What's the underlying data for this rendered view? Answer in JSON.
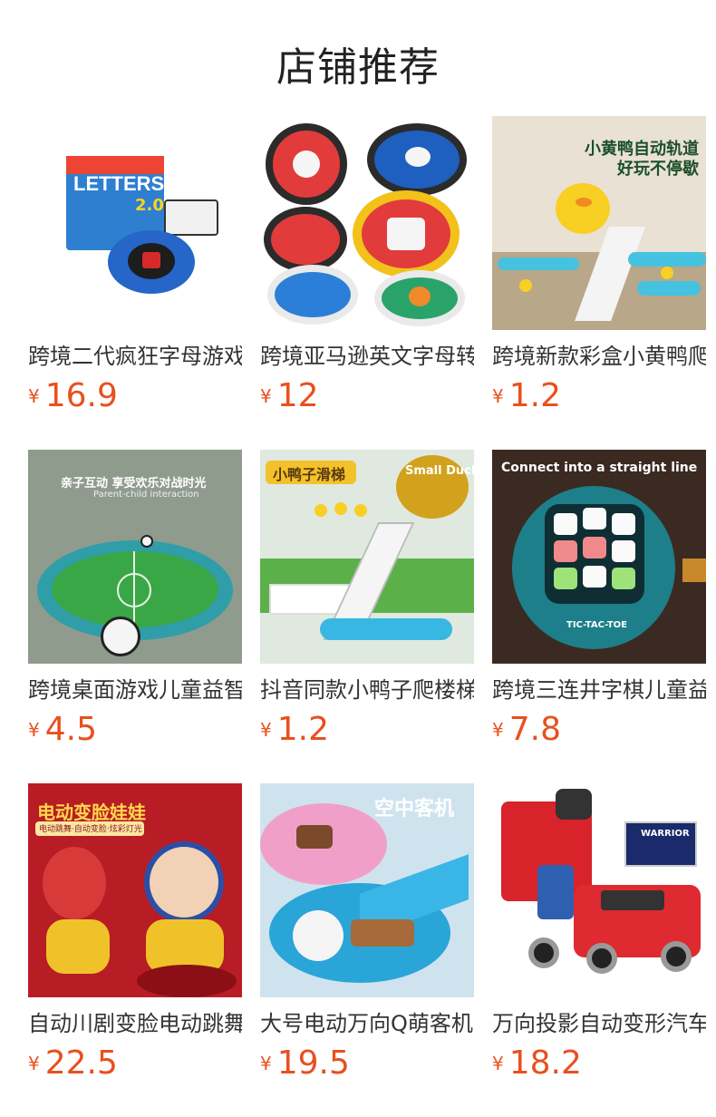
{
  "page_title": "店铺推荐",
  "currency_symbol": "¥",
  "products": [
    {
      "name": "跨境二代疯狂字母游戏",
      "price": "16.9",
      "image_text": "LETTERS",
      "image_text2": "2.0"
    },
    {
      "name": "跨境亚马逊英文字母转盘",
      "price": "12"
    },
    {
      "name": "跨境新款彩盒小黄鸭爬楼梯",
      "price": "1.2",
      "image_text": "小黄鸭自动轨道",
      "image_text2": "好玩不停歇"
    },
    {
      "name": "跨境桌面游戏儿童益智足球",
      "price": "4.5",
      "image_text": "亲子互动 享受欢乐对战时光",
      "image_text2": "Parent-child interaction"
    },
    {
      "name": "抖音同款小鸭子爬楼梯",
      "price": "1.2",
      "image_text": "小鸭子滑梯",
      "image_text2": "Small Duck"
    },
    {
      "name": "跨境三连井字棋儿童益智",
      "price": "7.8",
      "image_text": "Connect into a straight line",
      "image_text2": "TIC-TAC-TOE"
    },
    {
      "name": "自动川剧变脸电动跳舞娃娃",
      "price": "22.5",
      "image_text": "电动变脸娃娃",
      "image_text2": "电动跳舞·自动变脸·炫彩灯光"
    },
    {
      "name": "大号电动万向Q萌客机",
      "price": "19.5",
      "image_text": "空中客机"
    },
    {
      "name": "万向投影自动变形汽车",
      "price": "18.2",
      "image_text": "WARRIOR"
    }
  ]
}
